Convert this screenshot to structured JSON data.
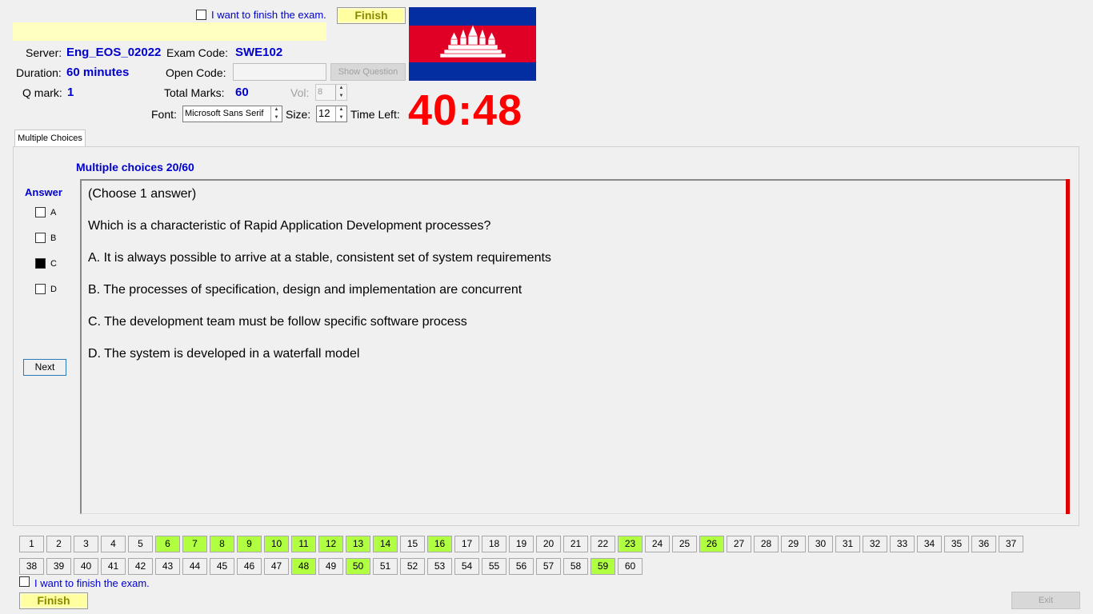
{
  "top": {
    "finish_check_label": "I want to finish the exam.",
    "finish_label": "Finish"
  },
  "info": {
    "server_label": "Server:",
    "server_value": "Eng_EOS_02022",
    "exam_code_label": "Exam Code:",
    "exam_code_value": "SWE102",
    "duration_label": "Duration:",
    "duration_value": "60 minutes",
    "open_code_label": "Open Code:",
    "open_code_value": "",
    "show_question_label": "Show Question",
    "qmark_label": "Q mark:",
    "qmark_value": "1",
    "total_marks_label": "Total Marks:",
    "total_marks_value": "60",
    "vol_label": "Vol:",
    "vol_value": "8",
    "font_label": "Font:",
    "font_value": "Microsoft Sans Serif",
    "size_label": "Size:",
    "size_value": "12",
    "time_left_label": "Time Left:",
    "time_left_value": "40:48"
  },
  "flag": {
    "icon": "cambodia-flag-icon",
    "colors": {
      "blue": "#032ea1",
      "red": "#e00025",
      "white": "#ffffff"
    }
  },
  "tab": {
    "label": "Multiple Choices"
  },
  "question": {
    "header": "Multiple choices 20/60",
    "instruction": "(Choose 1 answer)",
    "text": "Which is a characteristic of Rapid Application Development processes?",
    "options": [
      "A.  It is always possible to arrive at a stable, consistent set of system requirements",
      "B.  The processes of specification, design and implementation are concurrent",
      "C.  The development team must be follow specific software process",
      "D.  The system is developed in a waterfall model"
    ]
  },
  "answer": {
    "title": "Answer",
    "items": [
      {
        "label": "A",
        "checked": false
      },
      {
        "label": "B",
        "checked": false
      },
      {
        "label": "C",
        "checked": true
      },
      {
        "label": "D",
        "checked": false
      }
    ],
    "next_label": "Next"
  },
  "question_numbers": {
    "numbers": [
      "1",
      "2",
      "3",
      "4",
      "5",
      "6",
      "7",
      "8",
      "9",
      "10",
      "11",
      "12",
      "13",
      "14",
      "15",
      "16",
      "17",
      "18",
      "19",
      "20",
      "21",
      "22",
      "23",
      "24",
      "25",
      "26",
      "27",
      "28",
      "29",
      "30",
      "31",
      "32",
      "33",
      "34",
      "35",
      "36",
      "37",
      "38",
      "39",
      "40",
      "41",
      "42",
      "43",
      "44",
      "45",
      "46",
      "47",
      "48",
      "49",
      "50",
      "51",
      "52",
      "53",
      "54",
      "55",
      "56",
      "57",
      "58",
      "59",
      "60"
    ],
    "answered": [
      6,
      7,
      8,
      9,
      10,
      11,
      12,
      13,
      14,
      16,
      23,
      26,
      48,
      50,
      59
    ],
    "answered_color": "#b0ff40"
  },
  "bottom": {
    "finish_check_label": "I want to finish the exam.",
    "finish_label": "Finish",
    "exit_label": "Exit"
  }
}
